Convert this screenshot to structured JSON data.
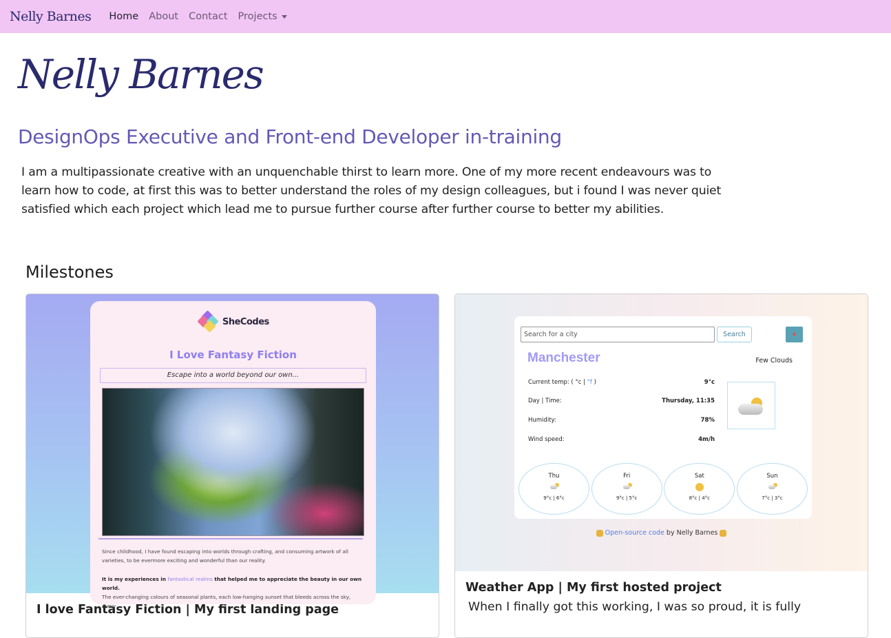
{
  "navbar": {
    "brand": "Nelly Barnes",
    "links": [
      {
        "label": "Home",
        "active": true
      },
      {
        "label": "About",
        "active": false
      },
      {
        "label": "Contact",
        "active": false
      },
      {
        "label": "Projects",
        "active": false,
        "dropdown": true
      }
    ]
  },
  "hero": {
    "name": "Nelly Barnes",
    "subtitle": "DesignOps Executive and Front-end Developer in-training",
    "intro": "I am a multipassionate creative with an unquenchable thirst to learn more. One of my more recent endeavours was to learn how to code, at first this was to better understand the roles of my design colleagues, but i found I was never quiet satisfied which each project which lead me to pursue further course after further course to better my abilities."
  },
  "milestones": {
    "title": "Milestones",
    "cards": [
      {
        "title": "I love Fantasy Fiction | My first landing page",
        "text": "",
        "preview": {
          "logo": "SheCodes",
          "heading": "I Love Fantasy Fiction",
          "tagline": "Escape into a world beyond our own...",
          "paragraph1": "Since childhood, I have found escaping into worlds through crafting, and consuming artwork of all varieties, to be evermore exciting and wonderful than our reality.",
          "paragraph2_bold_start": "It is my experiences in ",
          "paragraph2_link": "fantastical realms",
          "paragraph2_bold_end": " that helped me to appreciate the beauty in our own world.",
          "paragraph2_rest": "The ever-changing colours of seasonal plants, each low-hanging sunset that bleeds across the sky, every"
        }
      },
      {
        "title": "Weather App | My first hosted project",
        "text": "When I finally got this working, I was so proud, it is fully",
        "preview": {
          "search_placeholder": "Search for a city",
          "search_button": "Search",
          "location_icon": "map-pin-icon",
          "city": "Manchester",
          "description": "Few Clouds",
          "rows": [
            {
              "label": "Current temp: ( °c | ",
              "unit_f": "°f",
              "label_end": " )",
              "value": "9°c"
            },
            {
              "label": "Day | Time:",
              "value": "Thursday, 11:35"
            },
            {
              "label": "Humidity:",
              "value": "78%"
            },
            {
              "label": "Wind speed:",
              "value": "4m/h"
            }
          ],
          "forecast": [
            {
              "day": "Thu",
              "icon": "few-clouds",
              "temps": "9°c | 6°c"
            },
            {
              "day": "Fri",
              "icon": "few-clouds",
              "temps": "9°c | 5°c"
            },
            {
              "day": "Sat",
              "icon": "sun",
              "temps": "8°c | 4°c"
            },
            {
              "day": "Sun",
              "icon": "few-clouds",
              "temps": "7°c | 3°c"
            }
          ],
          "footer_link": "Open-source code",
          "footer_text": " by Nelly Barnes "
        }
      }
    ]
  },
  "colors": {
    "navbar_bg": "#f2c6f4",
    "brand": "#2a2a6e",
    "subtitle": "#6359b4",
    "accent_purple": "#8d7ff0",
    "weather_city": "#a19af7"
  }
}
